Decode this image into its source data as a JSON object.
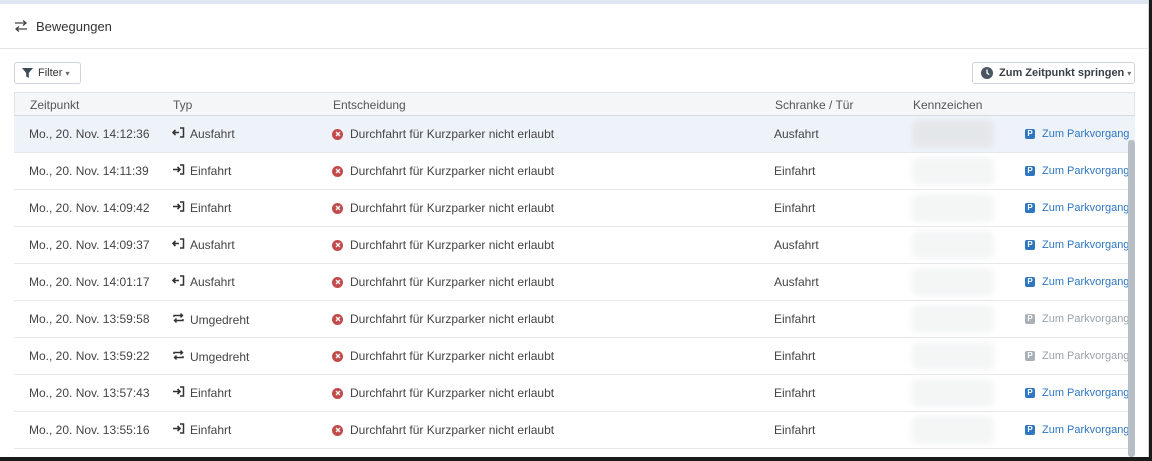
{
  "header": {
    "title": "Bewegungen",
    "icon": "swap-arrows-icon"
  },
  "toolbar": {
    "filter_label": "Filter",
    "jump_label": "Zum Zeitpunkt springen"
  },
  "table": {
    "columns": [
      "Zeitpunkt",
      "Typ",
      "Entscheidung",
      "Schranke / Tür",
      "Kennzeichen"
    ],
    "rows": [
      {
        "zeitpunkt": "Mo., 20. Nov.  14:12:36",
        "typ": "Ausfahrt",
        "typ_icon": "exit-arrow-icon",
        "entscheidung": "Durchfahrt für Kurzparker nicht erlaubt",
        "schranke": "Ausfahrt",
        "link": "Zum Parkvorgang",
        "link_enabled": true
      },
      {
        "zeitpunkt": "Mo., 20. Nov.  14:11:39",
        "typ": "Einfahrt",
        "typ_icon": "enter-arrow-icon",
        "entscheidung": "Durchfahrt für Kurzparker nicht erlaubt",
        "schranke": "Einfahrt",
        "link": "Zum Parkvorgang",
        "link_enabled": true
      },
      {
        "zeitpunkt": "Mo., 20. Nov.  14:09:42",
        "typ": "Einfahrt",
        "typ_icon": "enter-arrow-icon",
        "entscheidung": "Durchfahrt für Kurzparker nicht erlaubt",
        "schranke": "Einfahrt",
        "link": "Zum Parkvorgang",
        "link_enabled": true
      },
      {
        "zeitpunkt": "Mo., 20. Nov.  14:09:37",
        "typ": "Ausfahrt",
        "typ_icon": "exit-arrow-icon",
        "entscheidung": "Durchfahrt für Kurzparker nicht erlaubt",
        "schranke": "Ausfahrt",
        "link": "Zum Parkvorgang",
        "link_enabled": true
      },
      {
        "zeitpunkt": "Mo., 20. Nov.  14:01:17",
        "typ": "Ausfahrt",
        "typ_icon": "exit-arrow-icon",
        "entscheidung": "Durchfahrt für Kurzparker nicht erlaubt",
        "schranke": "Ausfahrt",
        "link": "Zum Parkvorgang",
        "link_enabled": true
      },
      {
        "zeitpunkt": "Mo., 20. Nov.  13:59:58",
        "typ": "Umgedreht",
        "typ_icon": "turn-around-icon",
        "entscheidung": "Durchfahrt für Kurzparker nicht erlaubt",
        "schranke": "Einfahrt",
        "link": "Zum Parkvorgang",
        "link_enabled": false
      },
      {
        "zeitpunkt": "Mo., 20. Nov.  13:59:22",
        "typ": "Umgedreht",
        "typ_icon": "turn-around-icon",
        "entscheidung": "Durchfahrt für Kurzparker nicht erlaubt",
        "schranke": "Einfahrt",
        "link": "Zum Parkvorgang",
        "link_enabled": false
      },
      {
        "zeitpunkt": "Mo., 20. Nov.  13:57:43",
        "typ": "Einfahrt",
        "typ_icon": "enter-arrow-icon",
        "entscheidung": "Durchfahrt für Kurzparker nicht erlaubt",
        "schranke": "Einfahrt",
        "link": "Zum Parkvorgang",
        "link_enabled": true
      },
      {
        "zeitpunkt": "Mo., 20. Nov.  13:55:16",
        "typ": "Einfahrt",
        "typ_icon": "enter-arrow-icon",
        "entscheidung": "Durchfahrt für Kurzparker nicht erlaubt",
        "schranke": "Einfahrt",
        "link": "Zum Parkvorgang",
        "link_enabled": true
      }
    ]
  },
  "colors": {
    "link": "#2e76c2",
    "link_disabled": "#9aa2ab",
    "error": "#c24a4a",
    "selected_row": "#eef3fa"
  }
}
